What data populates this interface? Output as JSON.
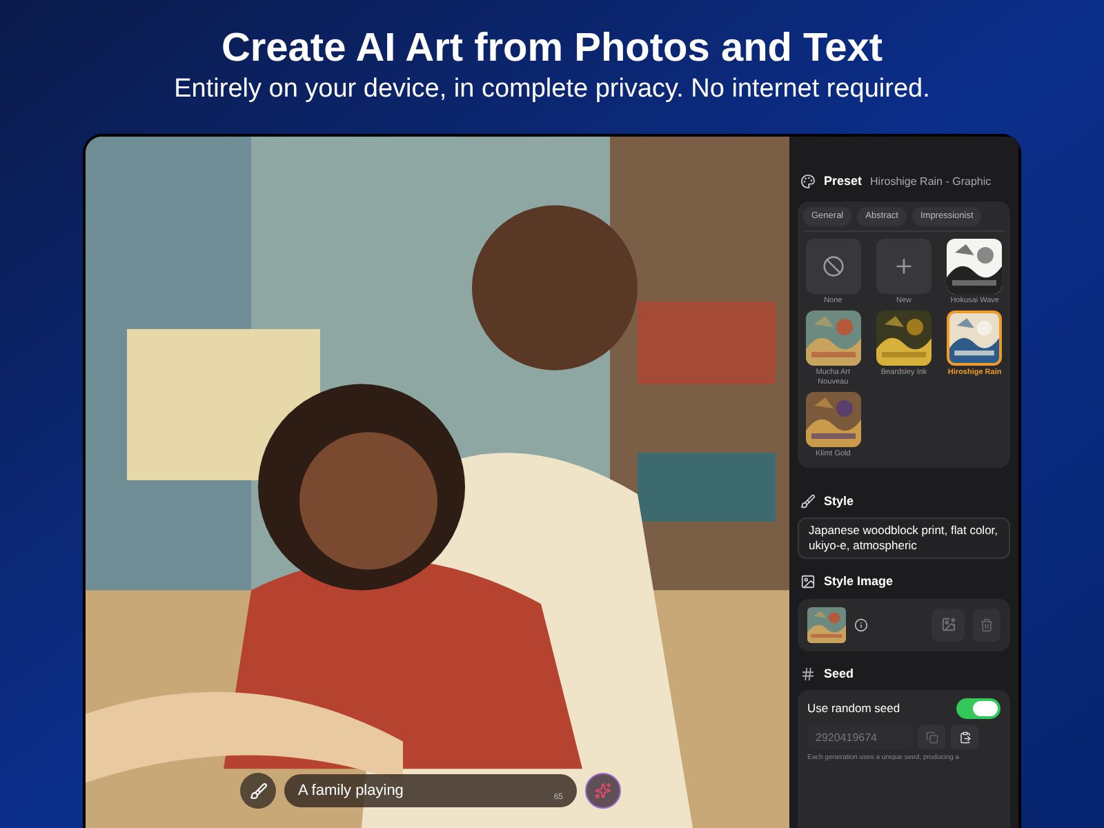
{
  "headline": "Create AI Art from Photos and Text",
  "subheadline": "Entirely on your device, in complete privacy. No internet required.",
  "prompt": {
    "value": "A family playing",
    "count": "65"
  },
  "preset": {
    "label": "Preset",
    "value": "Hiroshige Rain - Graphic",
    "categories": [
      {
        "label": "General",
        "selected": false
      },
      {
        "label": "Abstract",
        "selected": false
      },
      {
        "label": "Impressionist",
        "selected": false
      }
    ],
    "items": [
      {
        "label": "None",
        "kind": "none",
        "selected": false
      },
      {
        "label": "New",
        "kind": "new",
        "selected": false
      },
      {
        "label": "Hokusai Wave",
        "kind": "picture",
        "selected": false
      },
      {
        "label": "Mucha Art Nouveau",
        "kind": "picture",
        "selected": false
      },
      {
        "label": "Beardsley Ink",
        "kind": "picture",
        "selected": false
      },
      {
        "label": "Hiroshige Rain",
        "kind": "picture",
        "selected": true
      },
      {
        "label": "Klimt Gold",
        "kind": "picture",
        "selected": false
      }
    ]
  },
  "style": {
    "label": "Style",
    "value": "Japanese woodblock print, flat color, ukiyo-e, atmospheric"
  },
  "style_image": {
    "label": "Style Image"
  },
  "seed": {
    "label": "Seed",
    "random_label": "Use random seed",
    "random_on": true,
    "value": "2920419674",
    "value_disabled": true,
    "note": "Each generation uses a unique seed, producing a"
  }
}
